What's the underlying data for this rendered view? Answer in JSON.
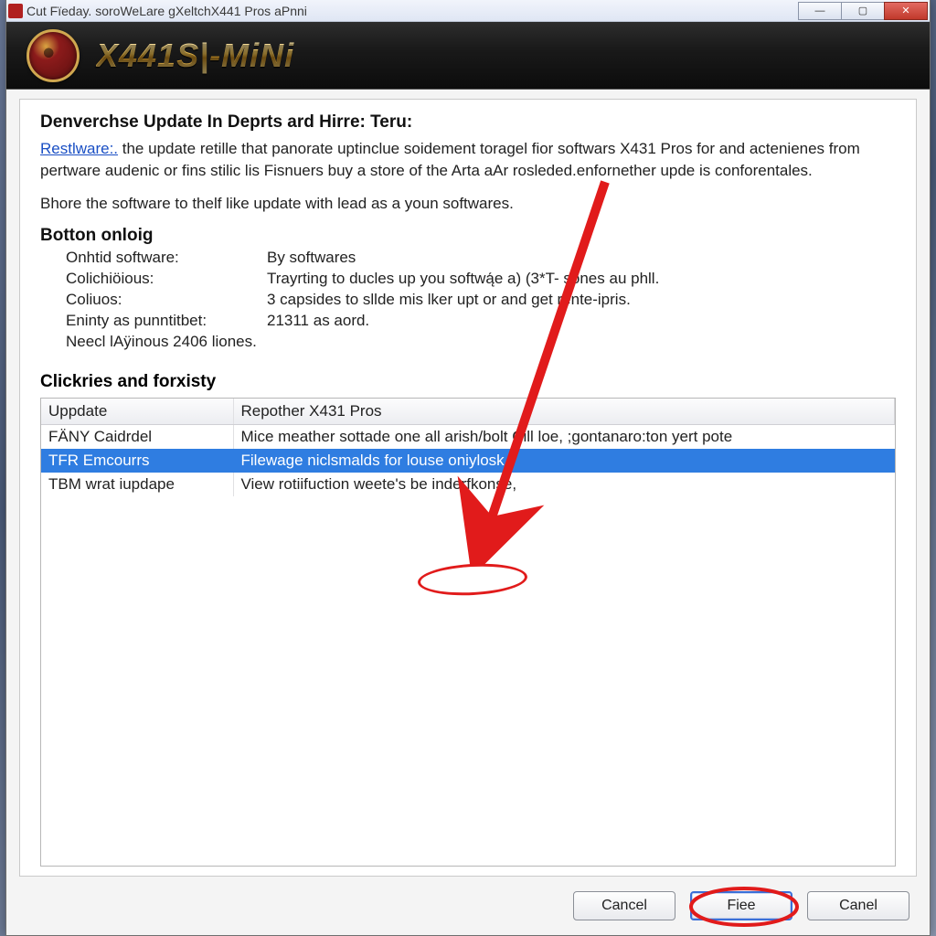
{
  "window": {
    "title": "Cut Fïeday. soroWeLare gXeltchX441 Pros aPnni"
  },
  "header": {
    "product_name": "X441S|-MiNi"
  },
  "intro": {
    "heading": "Denverchse Update In Deprts ard Hirre: Teru:",
    "link_text": "Restlware:.",
    "body": " the update retille that panorate uptinclue soidement toragel fior softwars X431 Pros for and actenienes from pertware audenic or fins stilic lis Fisnuers buy a store of the Arta aAr rosleded.enfornether upde is conforentales.",
    "subline": "Bhore the software to thelf like update with lead as a youn softwares."
  },
  "section2_title": "Botton onloig",
  "kv": [
    {
      "k": "Onhtid software:",
      "v": "By softwares"
    },
    {
      "k": "Colichiöious:",
      "v": "Trayrting to ducles up you softwą́e a) (3*T- sones au phll."
    },
    {
      "k": "Coliuos:",
      "v": "3 capsides to sllde mis lker upt or and get rente-ipris."
    },
    {
      "k": "Eninty as punntitbet:",
      "v": "21311 as aord."
    },
    {
      "k": "Neecl lAÿinous 2406 liones.",
      "v": ""
    }
  ],
  "list_title": "Clickries and forxisty",
  "table": {
    "cols": [
      "Uppdate",
      "Repother X431 Pros"
    ],
    "rows": [
      {
        "c0": "FÄNY Caidrdel",
        "c1": "Mice meather sottade one all arish/bolt Cill loe, ;gontanaro:ton yert pote"
      },
      {
        "c0": "TFR Emcourrs",
        "c1": "Filewage   niclsmalds for louse oniylosk."
      },
      {
        "c0": "TBM wrat iupdape",
        "c1": "View rotiifuction weete's be inderfkonse,"
      }
    ],
    "selected_index": 1
  },
  "buttons": {
    "cancel": "Cancel",
    "primary": "Fiee",
    "canel": "Canel"
  },
  "colors": {
    "accent_blue": "#2f7de1",
    "annotation_red": "#e11b1b",
    "gold": "#e6b84a"
  }
}
